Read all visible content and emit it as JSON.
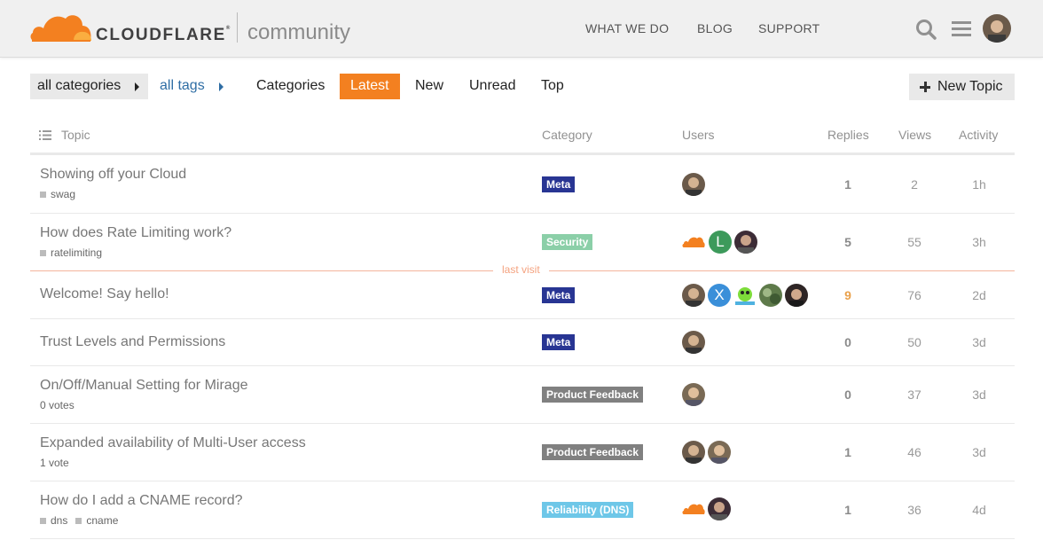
{
  "header": {
    "logo_word": "CLOUDFLARE",
    "logo_community": "community",
    "nav": [
      "WHAT WE DO",
      "BLOG",
      "SUPPORT"
    ],
    "icons": [
      "search-icon",
      "hamburger-menu-icon",
      "user-avatar"
    ]
  },
  "filters": {
    "category": "all categories",
    "tags": "all tags",
    "tabs": [
      "Categories",
      "Latest",
      "New",
      "Unread",
      "Top"
    ],
    "active_tab": "Latest",
    "new_topic": "New Topic"
  },
  "columns": {
    "topic": "Topic",
    "category": "Category",
    "users": "Users",
    "replies": "Replies",
    "views": "Views",
    "activity": "Activity"
  },
  "last_visit": "last visit",
  "colors": {
    "accent": "#f38020",
    "meta": "#283593",
    "security": "#8bcfa8",
    "product_feedback": "#808080",
    "reliability": "#6ec7e8"
  },
  "topics": [
    {
      "title": "Showing off your Cloud",
      "tags": [
        "swag"
      ],
      "extra": "",
      "category": "Meta",
      "replies": "1",
      "views": "2",
      "activity": "1h"
    },
    {
      "title": "How does Rate Limiting work?",
      "tags": [
        "ratelimiting"
      ],
      "extra": "",
      "category": "Security",
      "replies": "5",
      "views": "55",
      "activity": "3h"
    },
    {
      "title": "Welcome! Say hello!",
      "tags": [],
      "extra": "",
      "category": "Meta",
      "replies": "9",
      "views": "76",
      "activity": "2d"
    },
    {
      "title": "Trust Levels and Permissions",
      "tags": [],
      "extra": "",
      "category": "Meta",
      "replies": "0",
      "views": "50",
      "activity": "3d"
    },
    {
      "title": "On/Off/Manual Setting for Mirage",
      "tags": [],
      "extra": "0 votes",
      "category": "Product Feedback",
      "replies": "0",
      "views": "37",
      "activity": "3d"
    },
    {
      "title": "Expanded availability of Multi-User access",
      "tags": [],
      "extra": "1 vote",
      "category": "Product Feedback",
      "replies": "1",
      "views": "46",
      "activity": "3d"
    },
    {
      "title": "How do I add a CNAME record?",
      "tags": [
        "dns",
        "cname"
      ],
      "extra": "",
      "category": "Reliability (DNS)",
      "replies": "1",
      "views": "36",
      "activity": "4d"
    }
  ],
  "avatar_letters": {
    "L": "L",
    "X": "X"
  }
}
